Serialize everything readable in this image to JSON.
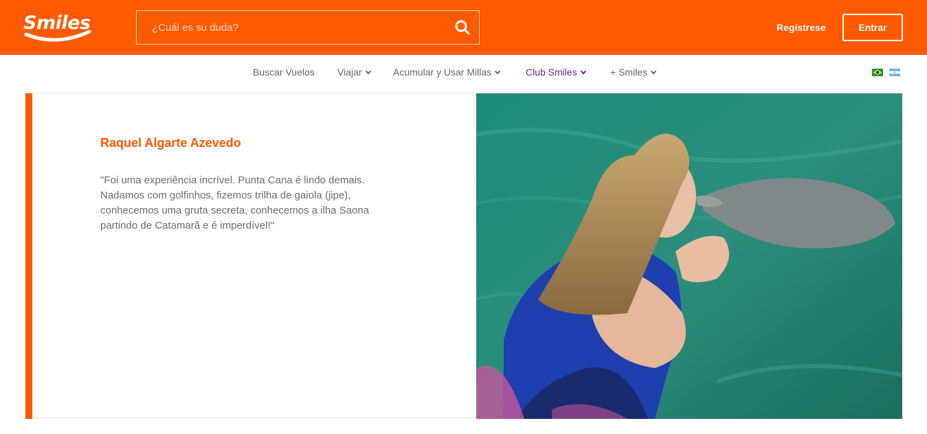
{
  "header": {
    "logo_text": "Smiles",
    "search_placeholder": "¿Cuál es su duda?",
    "register_label": "Regístrese",
    "login_label": "Entrar",
    "brand_color": "#ff5a00"
  },
  "nav": {
    "items": [
      {
        "label": "Buscar Vuelos",
        "has_dropdown": false
      },
      {
        "label": "Viajar",
        "has_dropdown": true
      },
      {
        "label": "Acumular y Usar Millas",
        "has_dropdown": true
      },
      {
        "label": "Club Smiles",
        "has_dropdown": true,
        "active": true
      },
      {
        "label": "+ Smiles",
        "has_dropdown": true
      }
    ],
    "active_color": "#5b2b92",
    "flags": [
      "brazil-flag-icon",
      "argentina-flag-icon"
    ]
  },
  "testimonial": {
    "name": "Raquel Algarte Azevedo",
    "quote": "\"Foi uma experiência incrível. Punta Cana é lindo demais. Nadamos com golfinhos, fizemos trilha de gaiola (jipe), conhecemos uma gruta secreta, conhecemos a ilha Saona partindo de Catamarã e é imperdível!\""
  }
}
